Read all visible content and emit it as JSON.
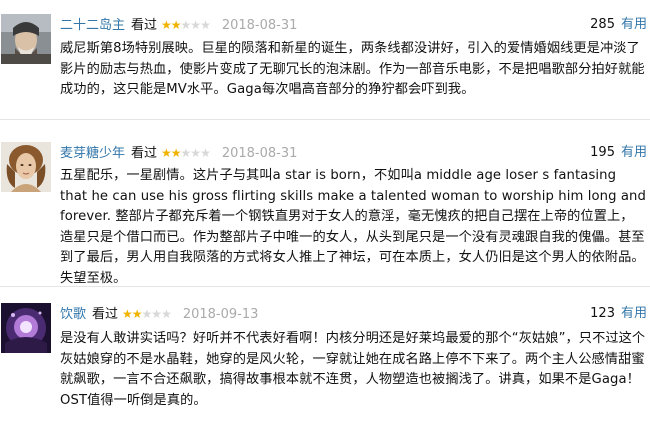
{
  "reviews": [
    {
      "username": "二十二岛主",
      "status": "看过",
      "rating": 2,
      "max_rating": 5,
      "date": "2018-08-31",
      "votes": "285",
      "vote_label": "有用",
      "avatar": "user-avatar-warrior",
      "content": "威尼斯第8场特别展映。巨星的陨落和新星的诞生，两条线都没讲好，引入的爱情婚姻线更是冲淡了影片的励志与热血，使影片变成了无聊冗长的泡沫剧。作为一部音乐电影，不是把唱歌部分拍好就能成功的，这只能是MV水平。Gaga每次唱高音部分的狰狞都会吓到我。"
    },
    {
      "username": "麦芽糖少年",
      "status": "看过",
      "rating": 2,
      "max_rating": 5,
      "date": "2018-08-31",
      "votes": "195",
      "vote_label": "有用",
      "avatar": "user-avatar-painting",
      "content": "五星配乐，一星剧情。这片子与其叫a star is born，不如叫a middle age loser s fantasing that he can use his gross flirting skills make a talented woman to worship him long and forever. 整部片子都充斥着一个钢铁直男对于女人的意淫，毫无愧疚的把自己摆在上帝的位置上，造星只是个借口而已。作为整部片子中唯一的女人，从头到尾只是一个没有灵魂跟自我的傀儡。甚至到了最后，男人用自我陨落的方式将女人推上了神坛，可在本质上，女人仍旧是这个男人的依附品。失望至极。"
    },
    {
      "username": "饮歌",
      "status": "看过",
      "rating": 2,
      "max_rating": 5,
      "date": "2018-09-13",
      "votes": "123",
      "vote_label": "有用",
      "avatar": "user-avatar-purple-glow",
      "content": "是没有人敢讲实话吗？好听并不代表好看啊！内核分明还是好莱坞最爱的那个“灰姑娘”，只不过这个灰姑娘穿的不是水晶鞋，她穿的是风火轮，一穿就让她在成名路上停不下来了。两个主人公感情甜蜜就飙歌，一言不合还飙歌，搞得故事根本就不连贯，人物塑造也被搁浅了。讲真，如果不是Gaga！OST值得一听倒是真的。"
    }
  ]
}
